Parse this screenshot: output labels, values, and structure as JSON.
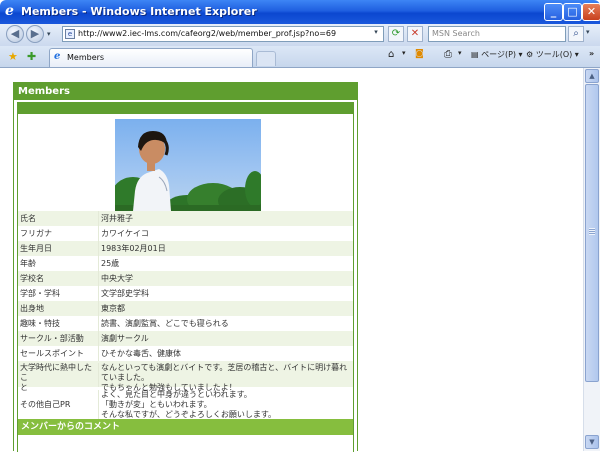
{
  "window": {
    "title": "Members - Windows Internet Explorer",
    "min_label": "_",
    "max_label": "□",
    "close_label": "✕"
  },
  "navbar": {
    "back_label": "◀",
    "forward_label": "▶",
    "url": "http://www2.iec-lms.com/cafeorg2/web/member_prof.jsp?no=69",
    "refresh_label": "⟳",
    "stop_label": "✕",
    "search_placeholder": "MSN Search",
    "search_go_label": "⌕"
  },
  "tabbar": {
    "tab_label": "Members",
    "page_menu": "ページ(P)",
    "tools_menu": "ツール(O)"
  },
  "panel": {
    "title": "Members",
    "profile": [
      {
        "key": "氏名",
        "value": "河井雅子"
      },
      {
        "key": "フリガナ",
        "value": "カワイケイコ"
      },
      {
        "key": "生年月日",
        "value": "1983年02月01日"
      },
      {
        "key": "年齢",
        "value": "25歳"
      },
      {
        "key": "学校名",
        "value": "中央大学"
      },
      {
        "key": "学部・学科",
        "value": "文学部史学科"
      },
      {
        "key": "出身地",
        "value": "東京都"
      },
      {
        "key": "趣味・特技",
        "value": "読書、演劇監賞、どこでも寝られる"
      },
      {
        "key": "サークル・部活動",
        "value": "演劇サークル"
      },
      {
        "key": "セールスポイント",
        "value": "ひそかな毒舌、健康体"
      }
    ],
    "college": {
      "key_line1": "大学時代に熱中したこ",
      "key_line2": "と",
      "value_line1": "なんといっても演劇とバイトです。芝居の稽古と、バイトに明け暮れていました。",
      "value_line2": "でもちゃんと勉強もしていましたよ！"
    },
    "pr": {
      "key": "その他自己PR",
      "value_line1": "よく、見た目と中身が違うといわれます。",
      "value_line2": "「動きが変」ともいわれます。",
      "value_line3": "そんな私ですが、どうぞよろしくお願いします。"
    },
    "comment_title": "メンバーからのコメント"
  }
}
